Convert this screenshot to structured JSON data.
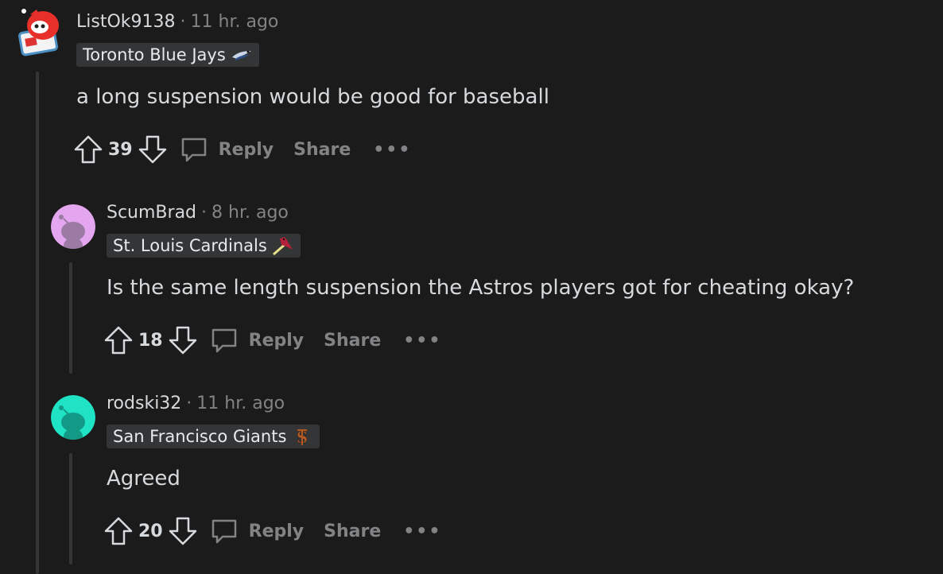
{
  "comments": [
    {
      "author": "ListOk9138",
      "time": "11 hr. ago",
      "flair": "Toronto Blue Jays",
      "flair_icon": "blue-jay-icon",
      "body": "a long suspension would be good for baseball",
      "votes": "39",
      "reply_label": "Reply",
      "share_label": "Share",
      "more_label": "•••"
    },
    {
      "author": "ScumBrad",
      "time": "8 hr. ago",
      "flair": "St. Louis Cardinals",
      "flair_icon": "cardinal-bird-icon",
      "body": "Is the same length suspension the Astros players got for cheating okay?",
      "votes": "18",
      "reply_label": "Reply",
      "share_label": "Share",
      "more_label": "•••"
    },
    {
      "author": "rodski32",
      "time": "11 hr. ago",
      "flair": "San Francisco Giants",
      "flair_icon": "sf-logo-icon",
      "body": "Agreed",
      "votes": "20",
      "reply_label": "Reply",
      "share_label": "Share",
      "more_label": "•••"
    }
  ],
  "colors": {
    "background": "#1b1b1c",
    "meta_text": "#818384",
    "body_text": "#d7dadc",
    "flair_bg": "#343536",
    "avatar_scumbrad": "#e4a6ef",
    "avatar_rodski": "#1fe3c4"
  },
  "separator": "·"
}
